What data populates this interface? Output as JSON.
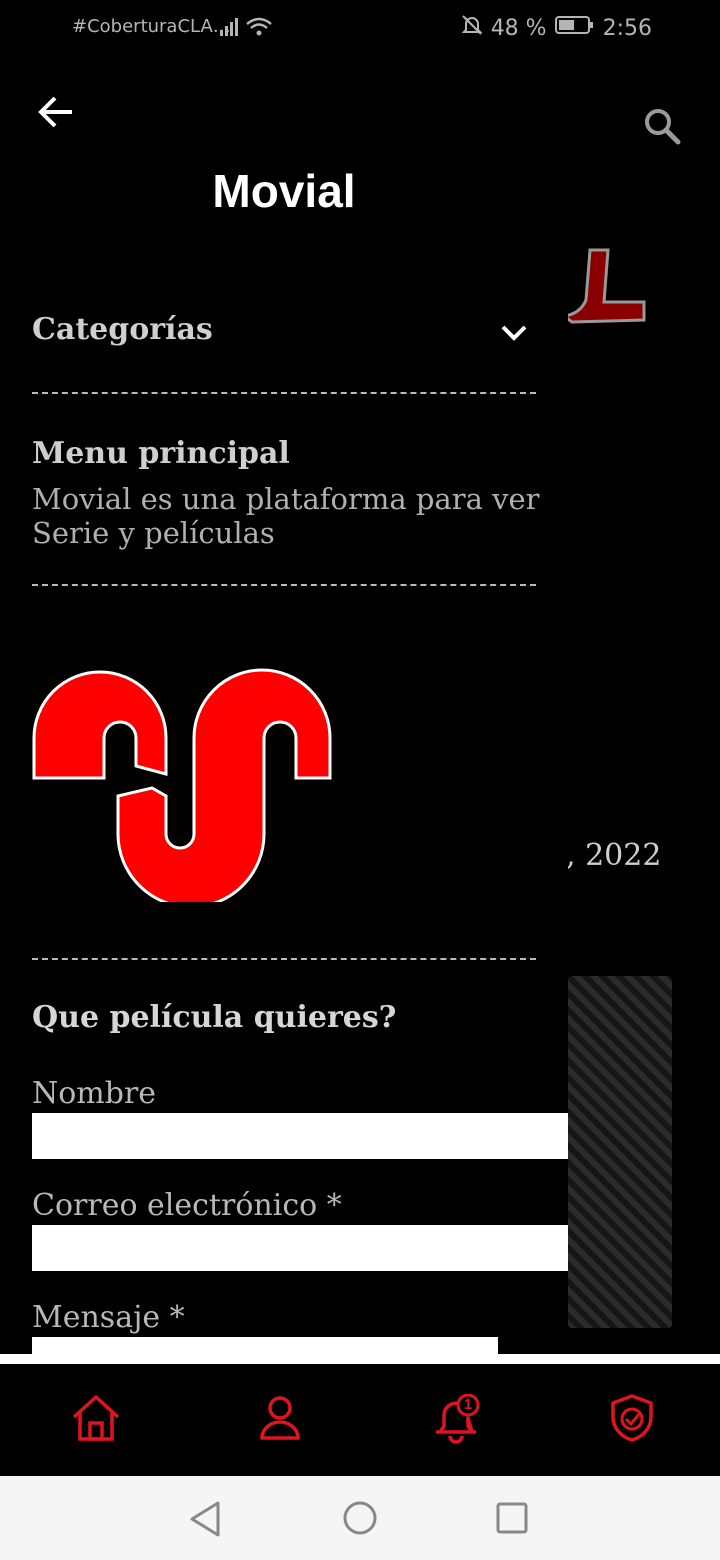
{
  "status_bar": {
    "carrier": "#CoberturaCLA…",
    "battery": "48 %",
    "time": "2:56"
  },
  "background": {
    "date_fragment": ", 2022"
  },
  "drawer": {
    "title": "Movial",
    "categories_label": "Categorías",
    "menu_title": "Menu principal",
    "menu_description": "Movial es una plataforma para ver Serie y películas",
    "form_title": "Que película quieres?",
    "fields": {
      "name_label": "Nombre",
      "email_label": "Correo electrónico *",
      "message_label": "Mensaje *"
    }
  },
  "bottom_nav": {
    "notification_count": "1",
    "icons": [
      "home-icon",
      "user-icon",
      "bell-icon",
      "shield-check-icon"
    ],
    "accent_color": "#e0141e"
  },
  "system_nav": {
    "icons": [
      "back-triangle-icon",
      "home-circle-icon",
      "recents-square-icon"
    ]
  },
  "colors": {
    "brand_red": "#ff0000",
    "background": "#000000"
  }
}
